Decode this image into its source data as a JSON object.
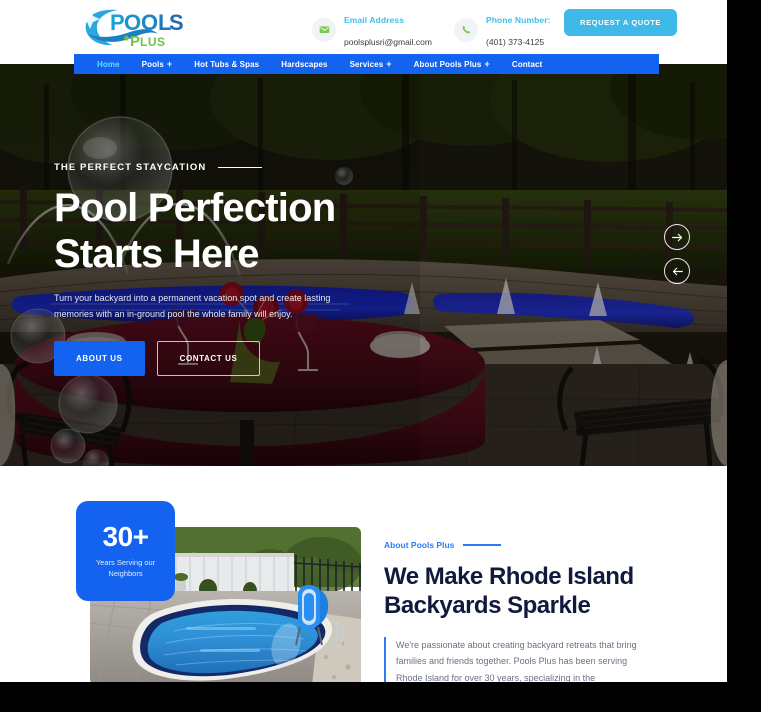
{
  "site": {
    "name": "Pools Plus",
    "logo": {
      "primary_word": "POOLS",
      "secondary_word": "PLUS"
    },
    "colors": {
      "nav_blue": "#1362f0",
      "accent_cyan": "#3fb9e8",
      "active_nav": "#5fe0ff",
      "logo_green": "#6cc24a",
      "heading_navy": "#111a3d",
      "body_gray": "#6a7186"
    }
  },
  "topbar": {
    "email": {
      "icon": "envelope-icon",
      "label": "Email Address",
      "value": "poolsplusri@gmail.com"
    },
    "phone": {
      "icon": "phone-icon",
      "label": "Phone Number:",
      "value": "(401) 373-4125"
    },
    "quote_button": "REQUEST A QUOTE"
  },
  "nav": {
    "items": [
      {
        "label": "Home",
        "has_dropdown": false,
        "active": true
      },
      {
        "label": "Pools",
        "has_dropdown": true,
        "active": false
      },
      {
        "label": "Hot Tubs & Spas",
        "has_dropdown": false,
        "active": false
      },
      {
        "label": "Hardscapes",
        "has_dropdown": false,
        "active": false
      },
      {
        "label": "Services",
        "has_dropdown": true,
        "active": false
      },
      {
        "label": "About Pools Plus",
        "has_dropdown": true,
        "active": false
      },
      {
        "label": "Contact",
        "has_dropdown": false,
        "active": false
      }
    ],
    "dropdown_glyph": "+"
  },
  "hero": {
    "eyebrow": "THE PERFECT STAYCATION",
    "title_line1": "Pool Perfection",
    "title_line2": "Starts Here",
    "subtitle": "Turn your backyard into a permanent vacation spot and create lasting memories with an in-ground pool the whole family will enjoy.",
    "primary_button": "ABOUT US",
    "secondary_button": "CONTACT US",
    "slider": {
      "next_icon": "arrow-right-icon",
      "prev_icon": "arrow-left-icon"
    }
  },
  "about": {
    "badge": {
      "number": "30+",
      "caption_line1": "Years Serving our",
      "caption_line2": "Neighbors"
    },
    "eyebrow": "About Pools Plus",
    "title_line1": "We Make Rhode Island",
    "title_line2": "Backyards Sparkle",
    "quote": "We're passionate about creating backyard retreats that bring families and friends together. Pools Plus has been serving Rhode Island for over 30 years, specializing in the",
    "image_alt": "freeform-inground-pool-photo"
  }
}
